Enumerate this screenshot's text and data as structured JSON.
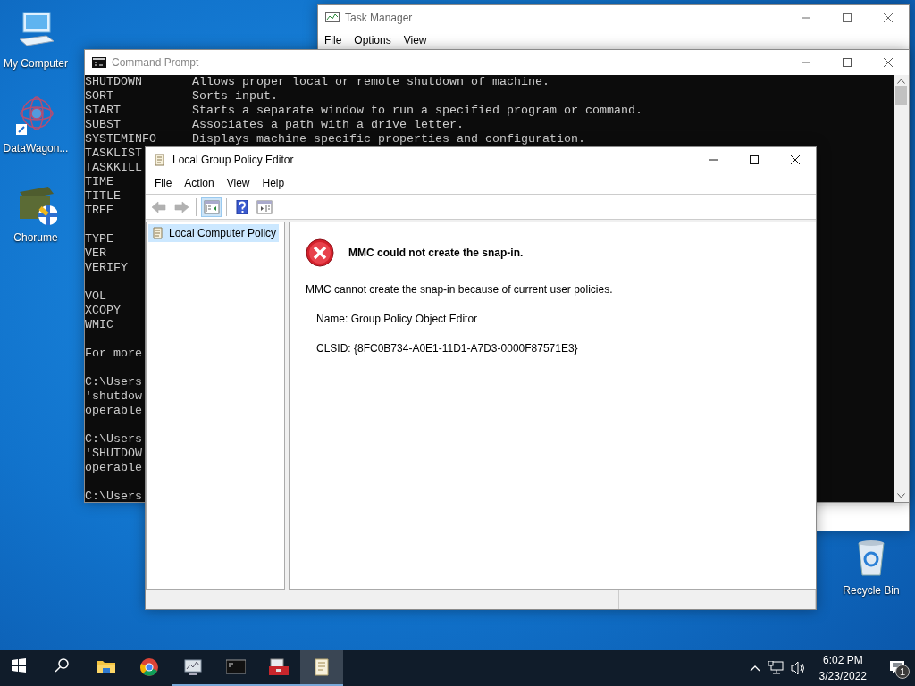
{
  "desktop_icons": [
    {
      "label": "My Computer",
      "kind": "computer"
    },
    {
      "label": "DataWagon...",
      "kind": "network"
    },
    {
      "label": "Chorume",
      "kind": "crate"
    },
    {
      "label": "Recycle Bin",
      "kind": "bin"
    }
  ],
  "task_manager": {
    "title": "Task Manager",
    "menu": [
      "File",
      "Options",
      "View"
    ]
  },
  "command_prompt": {
    "title": "Command Prompt",
    "blocks": [
      [
        [
          "SHUTDOWN",
          "Allows proper local or remote shutdown of machine."
        ],
        [
          "SORT",
          "Sorts input."
        ],
        [
          "START",
          "Starts a separate window to run a specified program or command."
        ],
        [
          "SUBST",
          "Associates a path with a drive letter."
        ],
        [
          "SYSTEMINFO",
          "Displays machine specific properties and configuration."
        ],
        [
          "TASKLIST"
        ],
        [
          "TASKKILL"
        ],
        [
          "TIME"
        ],
        [
          "TITLE"
        ],
        [
          "TREE"
        ]
      ],
      [
        [
          "TYPE"
        ],
        [
          "VER"
        ],
        [
          "VERIFY"
        ]
      ],
      [
        [
          "VOL"
        ],
        [
          "XCOPY"
        ],
        [
          "WMIC"
        ]
      ],
      [
        [
          "For more"
        ]
      ],
      [
        [
          "C:\\Users"
        ],
        [
          "'shutdow"
        ],
        [
          "operable"
        ]
      ],
      [
        [
          "C:\\Users"
        ],
        [
          "'SHUTDOW"
        ],
        [
          "operable"
        ]
      ],
      [
        [
          "C:\\Users"
        ]
      ]
    ]
  },
  "group_policy_editor": {
    "title": "Local Group Policy Editor",
    "menu": [
      "File",
      "Action",
      "View",
      "Help"
    ],
    "toolbar": [
      {
        "kind": "back",
        "disabled": true,
        "selected": false
      },
      {
        "kind": "forward",
        "disabled": true,
        "selected": false
      },
      {
        "kind": "tree",
        "disabled": false,
        "selected": true
      },
      {
        "kind": "help",
        "disabled": false,
        "selected": false
      },
      {
        "kind": "pane",
        "disabled": false,
        "selected": false
      }
    ],
    "tree": [
      {
        "label": "Local Computer Policy",
        "selected": true
      }
    ],
    "error": {
      "heading": "MMC could not create the snap-in.",
      "message": "MMC cannot create the snap-in because of current user policies.",
      "details": [
        "Name: Group Policy Object Editor",
        "CLSID: {8FC0B734-A0E1-11D1-A7D3-0000F87571E3}"
      ]
    }
  },
  "taskbar": {
    "items": [
      {
        "kind": "start",
        "running": false,
        "selected": false
      },
      {
        "kind": "search",
        "running": false,
        "selected": false
      },
      {
        "kind": "folder",
        "running": false,
        "selected": false
      },
      {
        "kind": "browser",
        "running": false,
        "selected": false
      },
      {
        "kind": "monitor",
        "running": true,
        "selected": false
      },
      {
        "kind": "console",
        "running": true,
        "selected": false
      },
      {
        "kind": "toolbox",
        "running": true,
        "selected": false
      },
      {
        "kind": "scroll",
        "running": true,
        "selected": true
      }
    ],
    "time": "6:02 PM",
    "date": "3/23/2022",
    "notifications": "1"
  }
}
